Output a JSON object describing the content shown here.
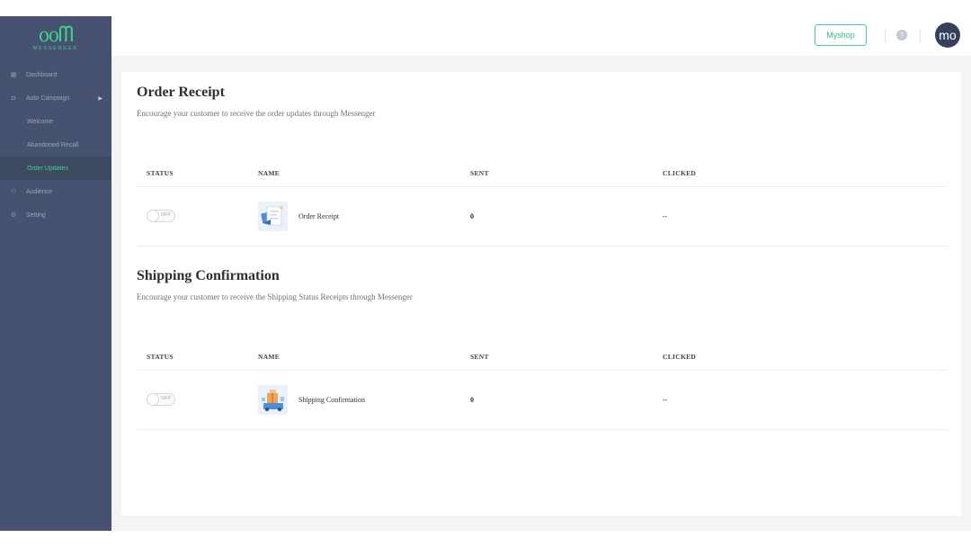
{
  "app": {
    "logo_text": "ᦞᦞᗰ",
    "logo_sub": "MESSENGER"
  },
  "sidebar": {
    "items": [
      {
        "label": "Dashboard",
        "icon": "grid-icon"
      },
      {
        "label": "Auto Campaign",
        "icon": "bubble-icon"
      },
      {
        "label": "Welcome"
      },
      {
        "label": "Abandoned Recall"
      },
      {
        "label": "Order Updates"
      },
      {
        "label": "Audience",
        "icon": "people-icon"
      },
      {
        "label": "Setting",
        "icon": "gear-icon"
      }
    ]
  },
  "topbar": {
    "shop_button": "Myshop",
    "help_icon": "?",
    "avatar": "mo"
  },
  "sections": [
    {
      "title": "Order Receipt",
      "description": "Encourage your customer to receive the order updates through Messenger",
      "columns": [
        "STATUS",
        "NAME",
        "SENT",
        "CLICKED"
      ],
      "row": {
        "toggle": "OFF",
        "name": "Order Receipt",
        "sent": "0",
        "clicked": "--"
      }
    },
    {
      "title": "Shipping Confirmation",
      "description": "Encourage your customer to receive the Shipping Status Receipts through Messenger",
      "columns": [
        "STATUS",
        "NAME",
        "SENT",
        "CLICKED"
      ],
      "row": {
        "toggle": "OFF",
        "name": "Shipping Confirmation",
        "sent": "0",
        "clicked": "--"
      }
    }
  ],
  "colors": {
    "sidebar_bg": "#46526f",
    "accent_green": "#3fd38d",
    "avatar_bg": "#36405c"
  }
}
